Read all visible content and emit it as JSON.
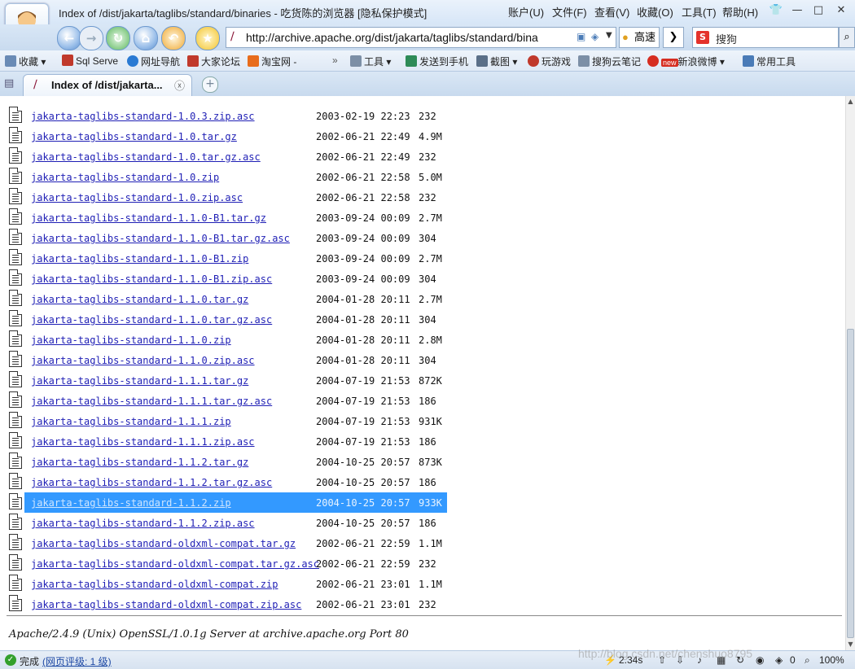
{
  "window": {
    "title": "Index of /dist/jakarta/taglibs/standard/binaries - 吃货陈的浏览器 [隐私保护模式]",
    "menus": [
      "账户(U)",
      "文件(F)",
      "查看(V)",
      "收藏(O)",
      "工具(T)",
      "帮助(H)"
    ]
  },
  "navbar": {
    "address": "http://archive.apache.org/dist/jakarta/taglibs/standard/bina",
    "speed_label": "高速",
    "search_placeholder": "搜狗"
  },
  "bookmarks": [
    {
      "label": "收藏",
      "color": "#6a8bb5"
    },
    {
      "label": "Sql Serve",
      "color": "#c0392b"
    },
    {
      "label": "网址导航",
      "color": "#2a7ad3"
    },
    {
      "label": "大家论坛",
      "color": "#c0392b"
    },
    {
      "label": "淘宝网 -",
      "color": "#e86c1b"
    },
    {
      "label": "工具",
      "color": "#7c8fa6"
    },
    {
      "label": "发送到手机",
      "color": "#2e8b57"
    },
    {
      "label": "截图",
      "color": "#5a6f88"
    },
    {
      "label": "玩游戏",
      "color": "#c0392b"
    },
    {
      "label": "搜狗云笔记",
      "color": "#7c8fa6"
    },
    {
      "label": "新浪微博",
      "color": "#d62d20"
    },
    {
      "label": "常用工具",
      "color": "#4a7bb7"
    }
  ],
  "tab": {
    "title": "Index of /dist/jakarta..."
  },
  "files": [
    {
      "name": "jakarta-taglibs-standard-1.0.3.zip.asc",
      "date": "2003-02-19 22:23",
      "size": "232",
      "type": "doc"
    },
    {
      "name": "jakarta-taglibs-standard-1.0.tar.gz",
      "date": "2002-06-21 22:49",
      "size": "4.9M",
      "type": "zip"
    },
    {
      "name": "jakarta-taglibs-standard-1.0.tar.gz.asc",
      "date": "2002-06-21 22:49",
      "size": "232",
      "type": "doc"
    },
    {
      "name": "jakarta-taglibs-standard-1.0.zip",
      "date": "2002-06-21 22:58",
      "size": "5.0M",
      "type": "zip"
    },
    {
      "name": "jakarta-taglibs-standard-1.0.zip.asc",
      "date": "2002-06-21 22:58",
      "size": "232",
      "type": "doc"
    },
    {
      "name": "jakarta-taglibs-standard-1.1.0-B1.tar.gz",
      "date": "2003-09-24 00:09",
      "size": "2.7M",
      "type": "zip"
    },
    {
      "name": "jakarta-taglibs-standard-1.1.0-B1.tar.gz.asc",
      "date": "2003-09-24 00:09",
      "size": "304",
      "type": "doc"
    },
    {
      "name": "jakarta-taglibs-standard-1.1.0-B1.zip",
      "date": "2003-09-24 00:09",
      "size": "2.7M",
      "type": "zip"
    },
    {
      "name": "jakarta-taglibs-standard-1.1.0-B1.zip.asc",
      "date": "2003-09-24 00:09",
      "size": "304",
      "type": "doc"
    },
    {
      "name": "jakarta-taglibs-standard-1.1.0.tar.gz",
      "date": "2004-01-28 20:11",
      "size": "2.7M",
      "type": "zip"
    },
    {
      "name": "jakarta-taglibs-standard-1.1.0.tar.gz.asc",
      "date": "2004-01-28 20:11",
      "size": "304",
      "type": "doc"
    },
    {
      "name": "jakarta-taglibs-standard-1.1.0.zip",
      "date": "2004-01-28 20:11",
      "size": "2.8M",
      "type": "zip"
    },
    {
      "name": "jakarta-taglibs-standard-1.1.0.zip.asc",
      "date": "2004-01-28 20:11",
      "size": "304",
      "type": "doc"
    },
    {
      "name": "jakarta-taglibs-standard-1.1.1.tar.gz",
      "date": "2004-07-19 21:53",
      "size": "872K",
      "type": "zip"
    },
    {
      "name": "jakarta-taglibs-standard-1.1.1.tar.gz.asc",
      "date": "2004-07-19 21:53",
      "size": "186",
      "type": "doc"
    },
    {
      "name": "jakarta-taglibs-standard-1.1.1.zip",
      "date": "2004-07-19 21:53",
      "size": "931K",
      "type": "zip"
    },
    {
      "name": "jakarta-taglibs-standard-1.1.1.zip.asc",
      "date": "2004-07-19 21:53",
      "size": "186",
      "type": "doc"
    },
    {
      "name": "jakarta-taglibs-standard-1.1.2.tar.gz",
      "date": "2004-10-25 20:57",
      "size": "873K",
      "type": "zip"
    },
    {
      "name": "jakarta-taglibs-standard-1.1.2.tar.gz.asc",
      "date": "2004-10-25 20:57",
      "size": "186",
      "type": "doc"
    },
    {
      "name": "jakarta-taglibs-standard-1.1.2.zip",
      "date": "2004-10-25 20:57",
      "size": "933K",
      "type": "zip",
      "selected": true
    },
    {
      "name": "jakarta-taglibs-standard-1.1.2.zip.asc",
      "date": "2004-10-25 20:57",
      "size": "186",
      "type": "doc"
    },
    {
      "name": "jakarta-taglibs-standard-oldxml-compat.tar.gz",
      "date": "2002-06-21 22:59",
      "size": "1.1M",
      "type": "zip"
    },
    {
      "name": "jakarta-taglibs-standard-oldxml-compat.tar.gz.asc",
      "date": "2002-06-21 22:59",
      "size": "232",
      "type": "doc"
    },
    {
      "name": "jakarta-taglibs-standard-oldxml-compat.zip",
      "date": "2002-06-21 23:01",
      "size": "1.1M",
      "type": "zip"
    },
    {
      "name": "jakarta-taglibs-standard-oldxml-compat.zip.asc",
      "date": "2002-06-21 23:01",
      "size": "232",
      "type": "doc"
    }
  ],
  "server_footer": "Apache/2.4.9 (Unix) OpenSSL/1.0.1g Server at archive.apache.org Port 80",
  "status": {
    "done": "完成",
    "rating": "(网页评级: 1 级)",
    "speed": "2.34s",
    "count": "0",
    "zoom": "100%"
  },
  "watermark": "http://blog.csdn.net/chenshuo8795"
}
